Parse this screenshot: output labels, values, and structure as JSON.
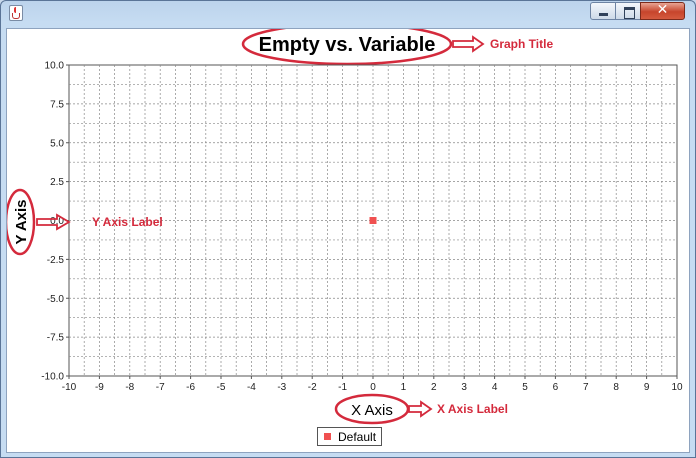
{
  "window": {
    "icon": "java-cup-icon",
    "buttons": {
      "minimize": "minimize-icon",
      "maximize": "maximize-icon",
      "close": "✕"
    }
  },
  "colors": {
    "annotation": "#d42a3c",
    "series_point": "#f05050",
    "grid": "#888888"
  },
  "annotations": {
    "graph_title": "Graph Title",
    "y_axis_label": "Y Axis Label",
    "x_axis_label": "X Axis Label"
  },
  "chart_data": {
    "type": "scatter",
    "title": "Empty vs. Variable",
    "xlabel": "X Axis",
    "ylabel": "Y Axis",
    "xlim": [
      -10,
      10
    ],
    "ylim": [
      -10,
      10
    ],
    "xticks": [
      -10,
      -9,
      -8,
      -7,
      -6,
      -5,
      -4,
      -3,
      -2,
      -1,
      0,
      1,
      2,
      3,
      4,
      5,
      6,
      7,
      8,
      9,
      10
    ],
    "yticks": [
      "10.0",
      "7.5",
      "5.0",
      "2.5",
      "0.0",
      "-2.5",
      "-5.0",
      "-7.5",
      "-10.0"
    ],
    "grid": true,
    "legend_position": "bottom",
    "series": [
      {
        "name": "Default",
        "x": [
          0
        ],
        "y": [
          0
        ]
      }
    ]
  }
}
